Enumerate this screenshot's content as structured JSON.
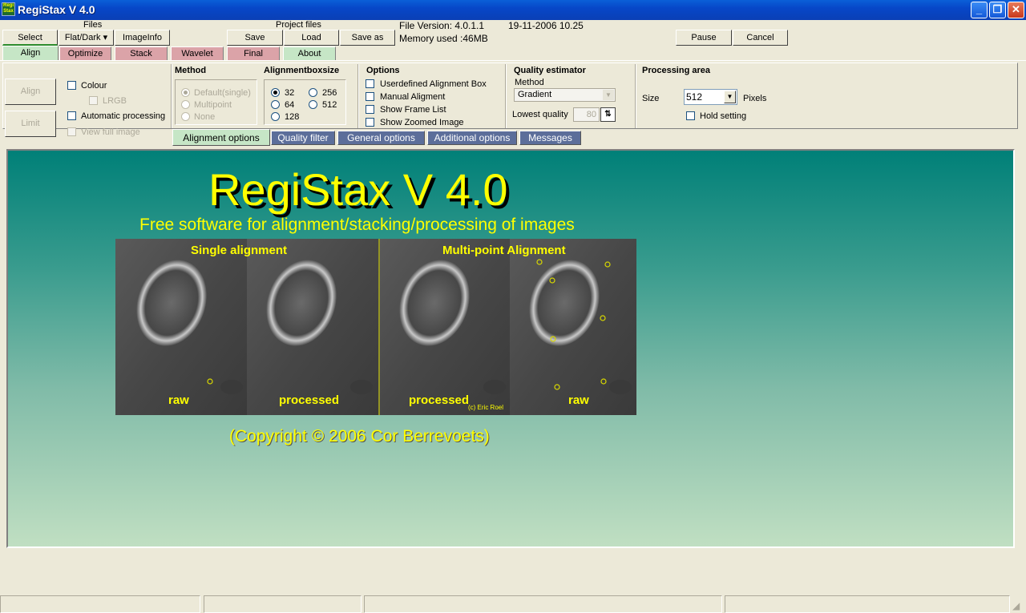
{
  "window": {
    "title": "RegiStax V 4.0",
    "minimize_glyph": "_",
    "restore_glyph": "❐",
    "close_glyph": "✕",
    "icon_text": "Regi Stax"
  },
  "toolbar": {
    "files_label": "Files",
    "select": "Select",
    "flatdark": "Flat/Dark ▾",
    "imageinfo": "ImageInfo",
    "project_files_label": "Project files",
    "save": "Save",
    "load": "Load",
    "save_as": "Save as",
    "file_version": "File Version: 4.0.1.1",
    "date": "19-11-2006 10.25",
    "memory": "Memory used :46MB",
    "pause": "Pause",
    "cancel": "Cancel"
  },
  "tabs": [
    {
      "label": "Align",
      "color": "#c6e6c6"
    },
    {
      "label": "Optimize",
      "color": "#dba3a8"
    },
    {
      "label": "Stack",
      "color": "#dba3a8"
    },
    {
      "label": "Wavelet",
      "color": "#dba3a8"
    },
    {
      "label": "Final",
      "color": "#dba3a8"
    },
    {
      "label": "About",
      "color": "#c6e6c6"
    }
  ],
  "left_panel": {
    "align_button": "Align",
    "limit_button": "Limit",
    "colour": "Colour",
    "lrgb": "LRGB",
    "automatic_processing": "Automatic processing",
    "view_full_image": "View full image"
  },
  "method": {
    "title": "Method",
    "options": [
      "Default(single)",
      "Multipoint",
      "None"
    ]
  },
  "alignmentbox": {
    "title": "Alignmentboxsize",
    "options": [
      "32",
      "256",
      "64",
      "512",
      "128"
    ],
    "selected": "32"
  },
  "options": {
    "title": "Options",
    "items": [
      "Userdefined Alignment Box",
      "Manual Aligment",
      "Show Frame List",
      "Show Zoomed Image"
    ]
  },
  "quality": {
    "title": "Quality estimator",
    "method_label": "Method",
    "method_value": "Gradient",
    "lowest_label": "Lowest quality",
    "lowest_value": "80"
  },
  "processing_area": {
    "title": "Processing area",
    "size_label": "Size",
    "size_value": "512",
    "pixels_label": "Pixels",
    "hold_setting": "Hold setting"
  },
  "subtabs": [
    {
      "label": "Alignment  options",
      "active": true
    },
    {
      "label": "Quality  filter",
      "active": false
    },
    {
      "label": "General options",
      "active": false
    },
    {
      "label": "Additional options",
      "active": false
    },
    {
      "label": "Messages",
      "active": false
    }
  ],
  "banner": {
    "title": "RegiStax V 4.0",
    "subtitle": "Free software for alignment/stacking/processing of images",
    "single_alignment": "Single alignment",
    "multipoint_alignment": "Multi-point Alignment",
    "raw_1": "raw",
    "processed_1": "processed",
    "processed_2": "processed",
    "raw_2": "raw",
    "photo_credit": "(c) Eric Roel",
    "copyright": "(Copyright © 2006 Cor Berrevoets)"
  }
}
